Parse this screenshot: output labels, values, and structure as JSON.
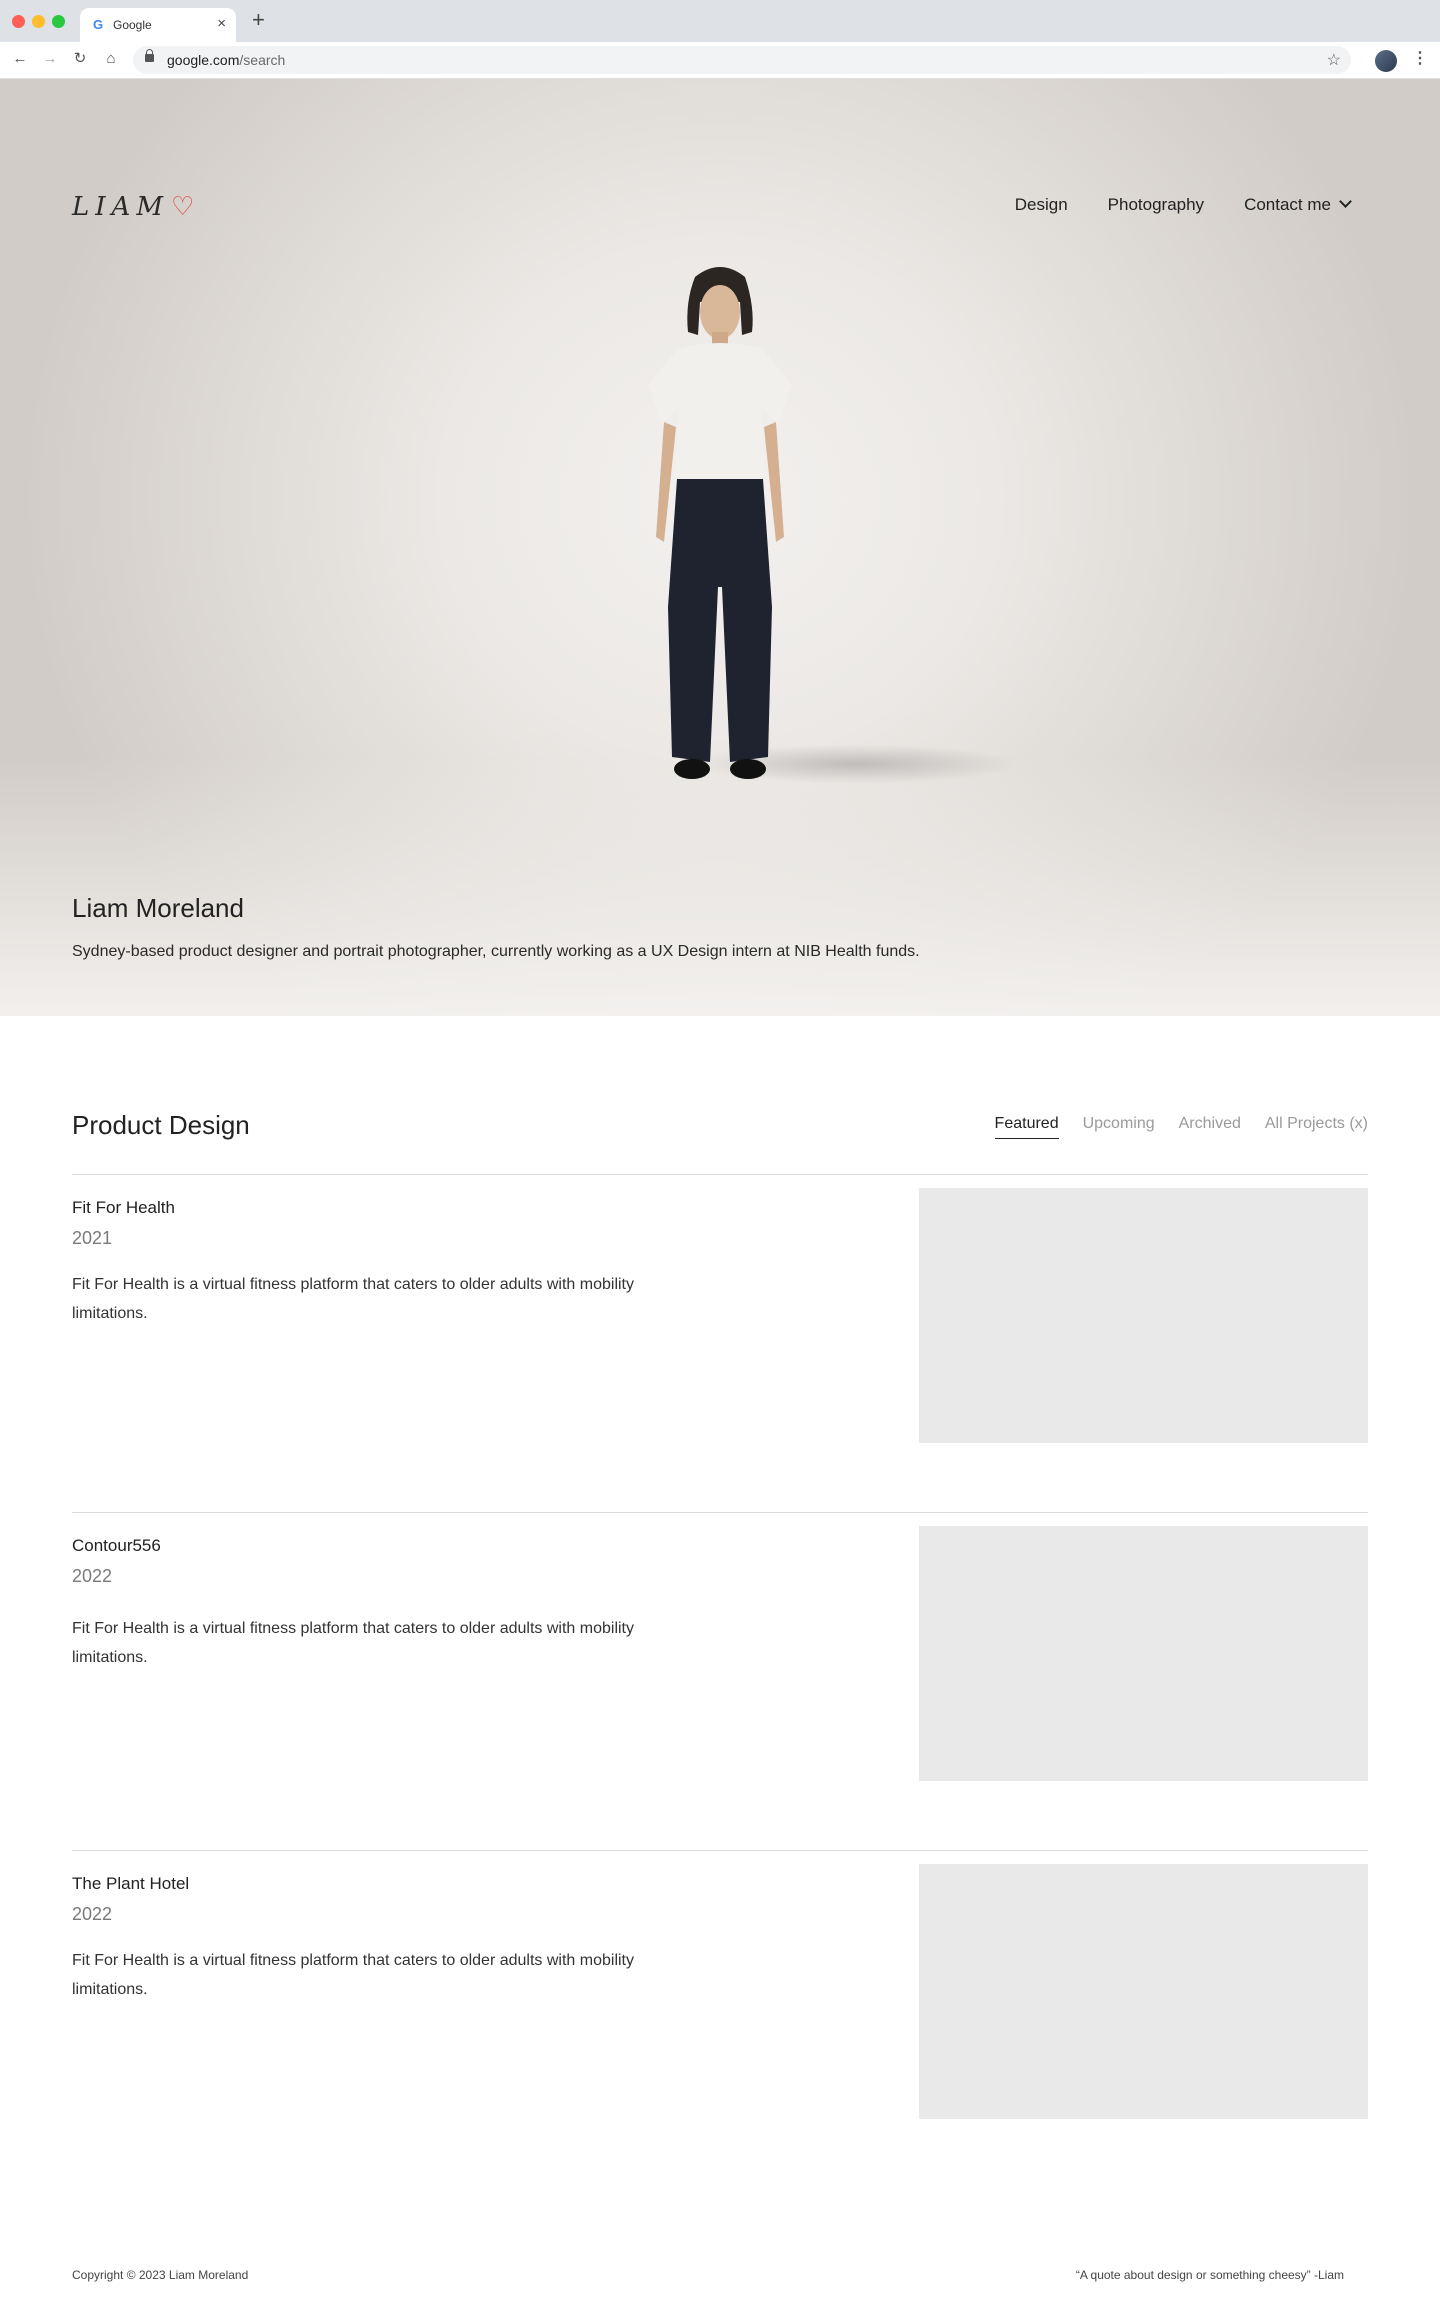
{
  "browser": {
    "tab_title": "Google",
    "tab_favicon": "G",
    "close_glyph": "×",
    "new_tab_glyph": "+",
    "url_host": "google.com",
    "url_path": "/search"
  },
  "site": {
    "logo_text": "LIAM",
    "logo_heart": "♡",
    "nav": [
      {
        "label": "Design"
      },
      {
        "label": "Photography"
      },
      {
        "label": "Contact me"
      }
    ]
  },
  "hero": {
    "name": "Liam Moreland",
    "bio": "Sydney-based product designer and portrait photographer,  currently working as a UX Design intern at NIB Health funds."
  },
  "section": {
    "title": "Product Design",
    "filters": [
      {
        "label": "Featured",
        "active": true
      },
      {
        "label": "Upcoming",
        "active": false
      },
      {
        "label": "Archived",
        "active": false
      },
      {
        "label": "All Projects (x)",
        "active": false
      }
    ]
  },
  "projects": [
    {
      "name": "Fit For Health",
      "year": "2021",
      "description": "Fit For Health is a virtual fitness platform that caters to older adults with mobility limitations."
    },
    {
      "name": "Contour556",
      "year": "2022",
      "description": "Fit For Health is a virtual fitness platform that caters to older adults with mobility limitations."
    },
    {
      "name": "The Plant Hotel",
      "year": "2022",
      "description": "Fit For Health is a virtual fitness platform that caters to older adults with mobility limitations."
    }
  ],
  "footer": {
    "copyright": "Copyright © 2023 Liam Moreland",
    "quote": "“A quote about design or something cheesy” -Liam"
  },
  "colors": {
    "accent_heart": "#d94b4b",
    "thumb_placeholder": "#e9e9ea",
    "muted_text": "#9a9a9a"
  }
}
